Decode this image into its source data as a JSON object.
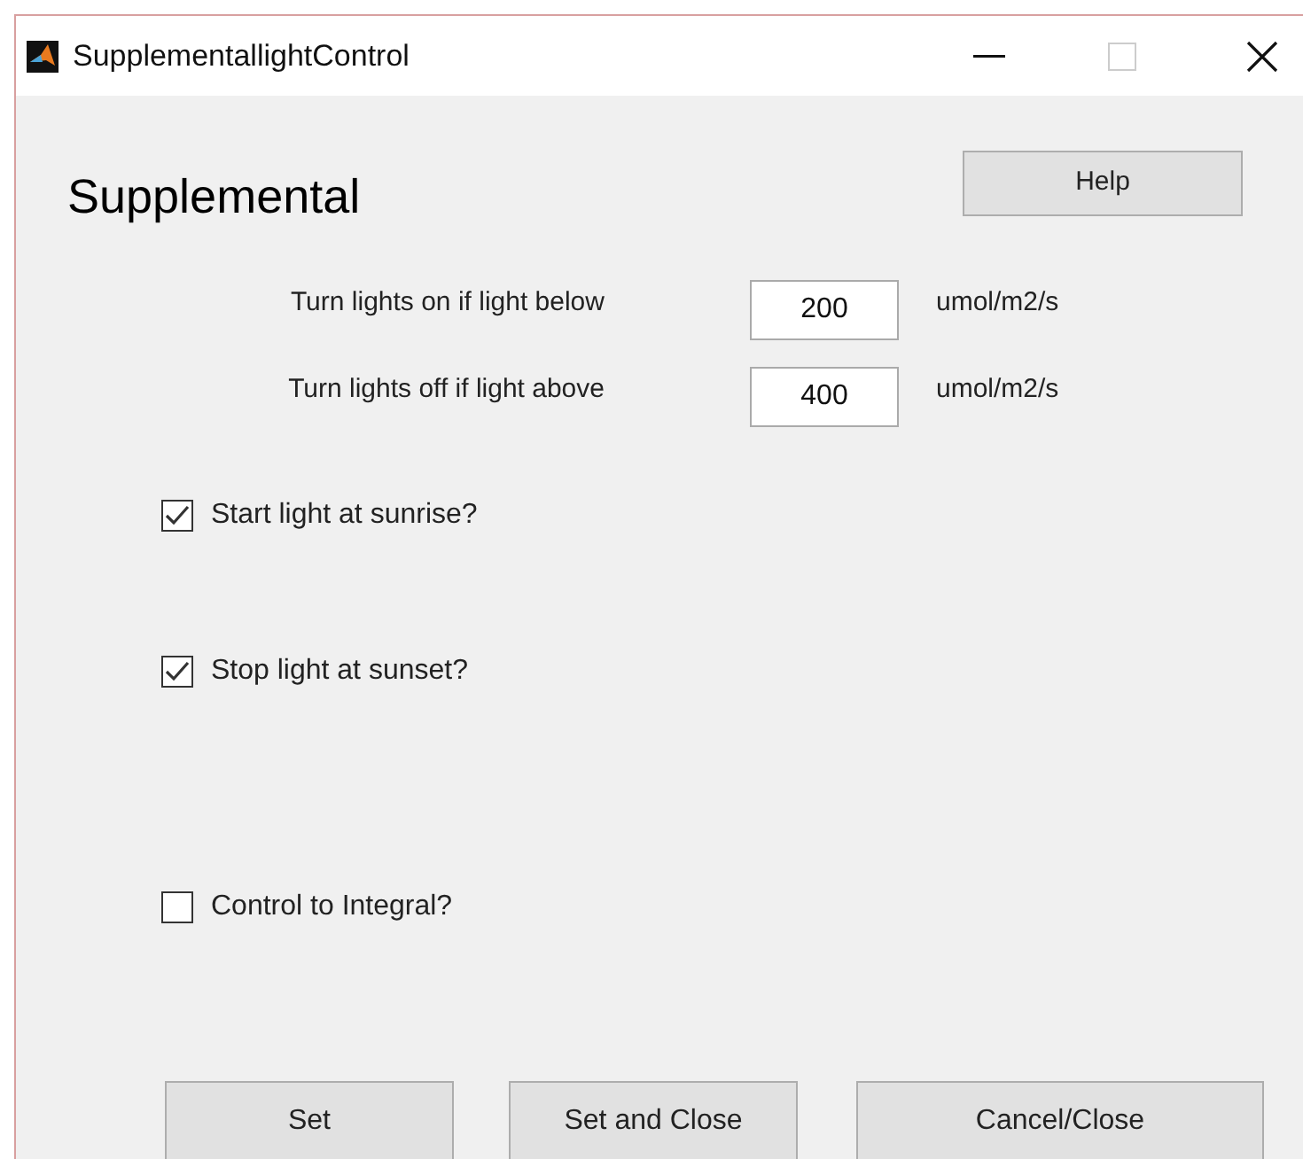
{
  "window": {
    "title": "SupplementallightControl"
  },
  "heading": "Supplemental",
  "help_button": "Help",
  "thresholds": [
    {
      "label": "Turn lights on if light below",
      "value": "200",
      "unit": "umol/m2/s"
    },
    {
      "label": "Turn lights off if light above",
      "value": "400",
      "unit": "umol/m2/s"
    }
  ],
  "options": [
    {
      "label": "Start light at sunrise?",
      "checked": true
    },
    {
      "label": "Stop light at sunset?",
      "checked": true
    },
    {
      "label": "Control to Integral?",
      "checked": false
    }
  ],
  "buttons": [
    "Set",
    "Set and Close",
    "Cancel/Close"
  ]
}
